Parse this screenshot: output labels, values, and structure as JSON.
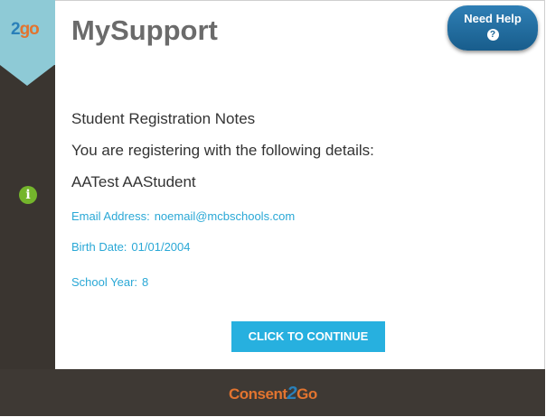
{
  "brand": {
    "logo_num": "2",
    "logo_word": "go"
  },
  "header": {
    "title": "MySupport",
    "help_label": "Need Help",
    "help_icon": "?"
  },
  "content": {
    "section_title": "Student Registration Notes",
    "intro": "You are registering with the following details:",
    "student_name": "AATest AAStudent",
    "fields": [
      {
        "label": "Email Address:",
        "value": "noemail@mcbschools.com"
      },
      {
        "label": "Birth Date:",
        "value": "01/01/2004"
      },
      {
        "label": "School Year:",
        "value": "8"
      }
    ],
    "continue_label": "CLICK TO CONTINUE"
  },
  "footer": {
    "logo_a": "Consent",
    "logo_num": "2",
    "logo_b": "Go"
  },
  "colors": {
    "accent": "#27b0df",
    "sidebar": "#3a3530",
    "help": "#1e6a9c",
    "info": "#74b52c",
    "brand_orange": "#e2742f"
  },
  "icons": {
    "info": "info-circle-icon",
    "help": "question-circle-icon"
  }
}
